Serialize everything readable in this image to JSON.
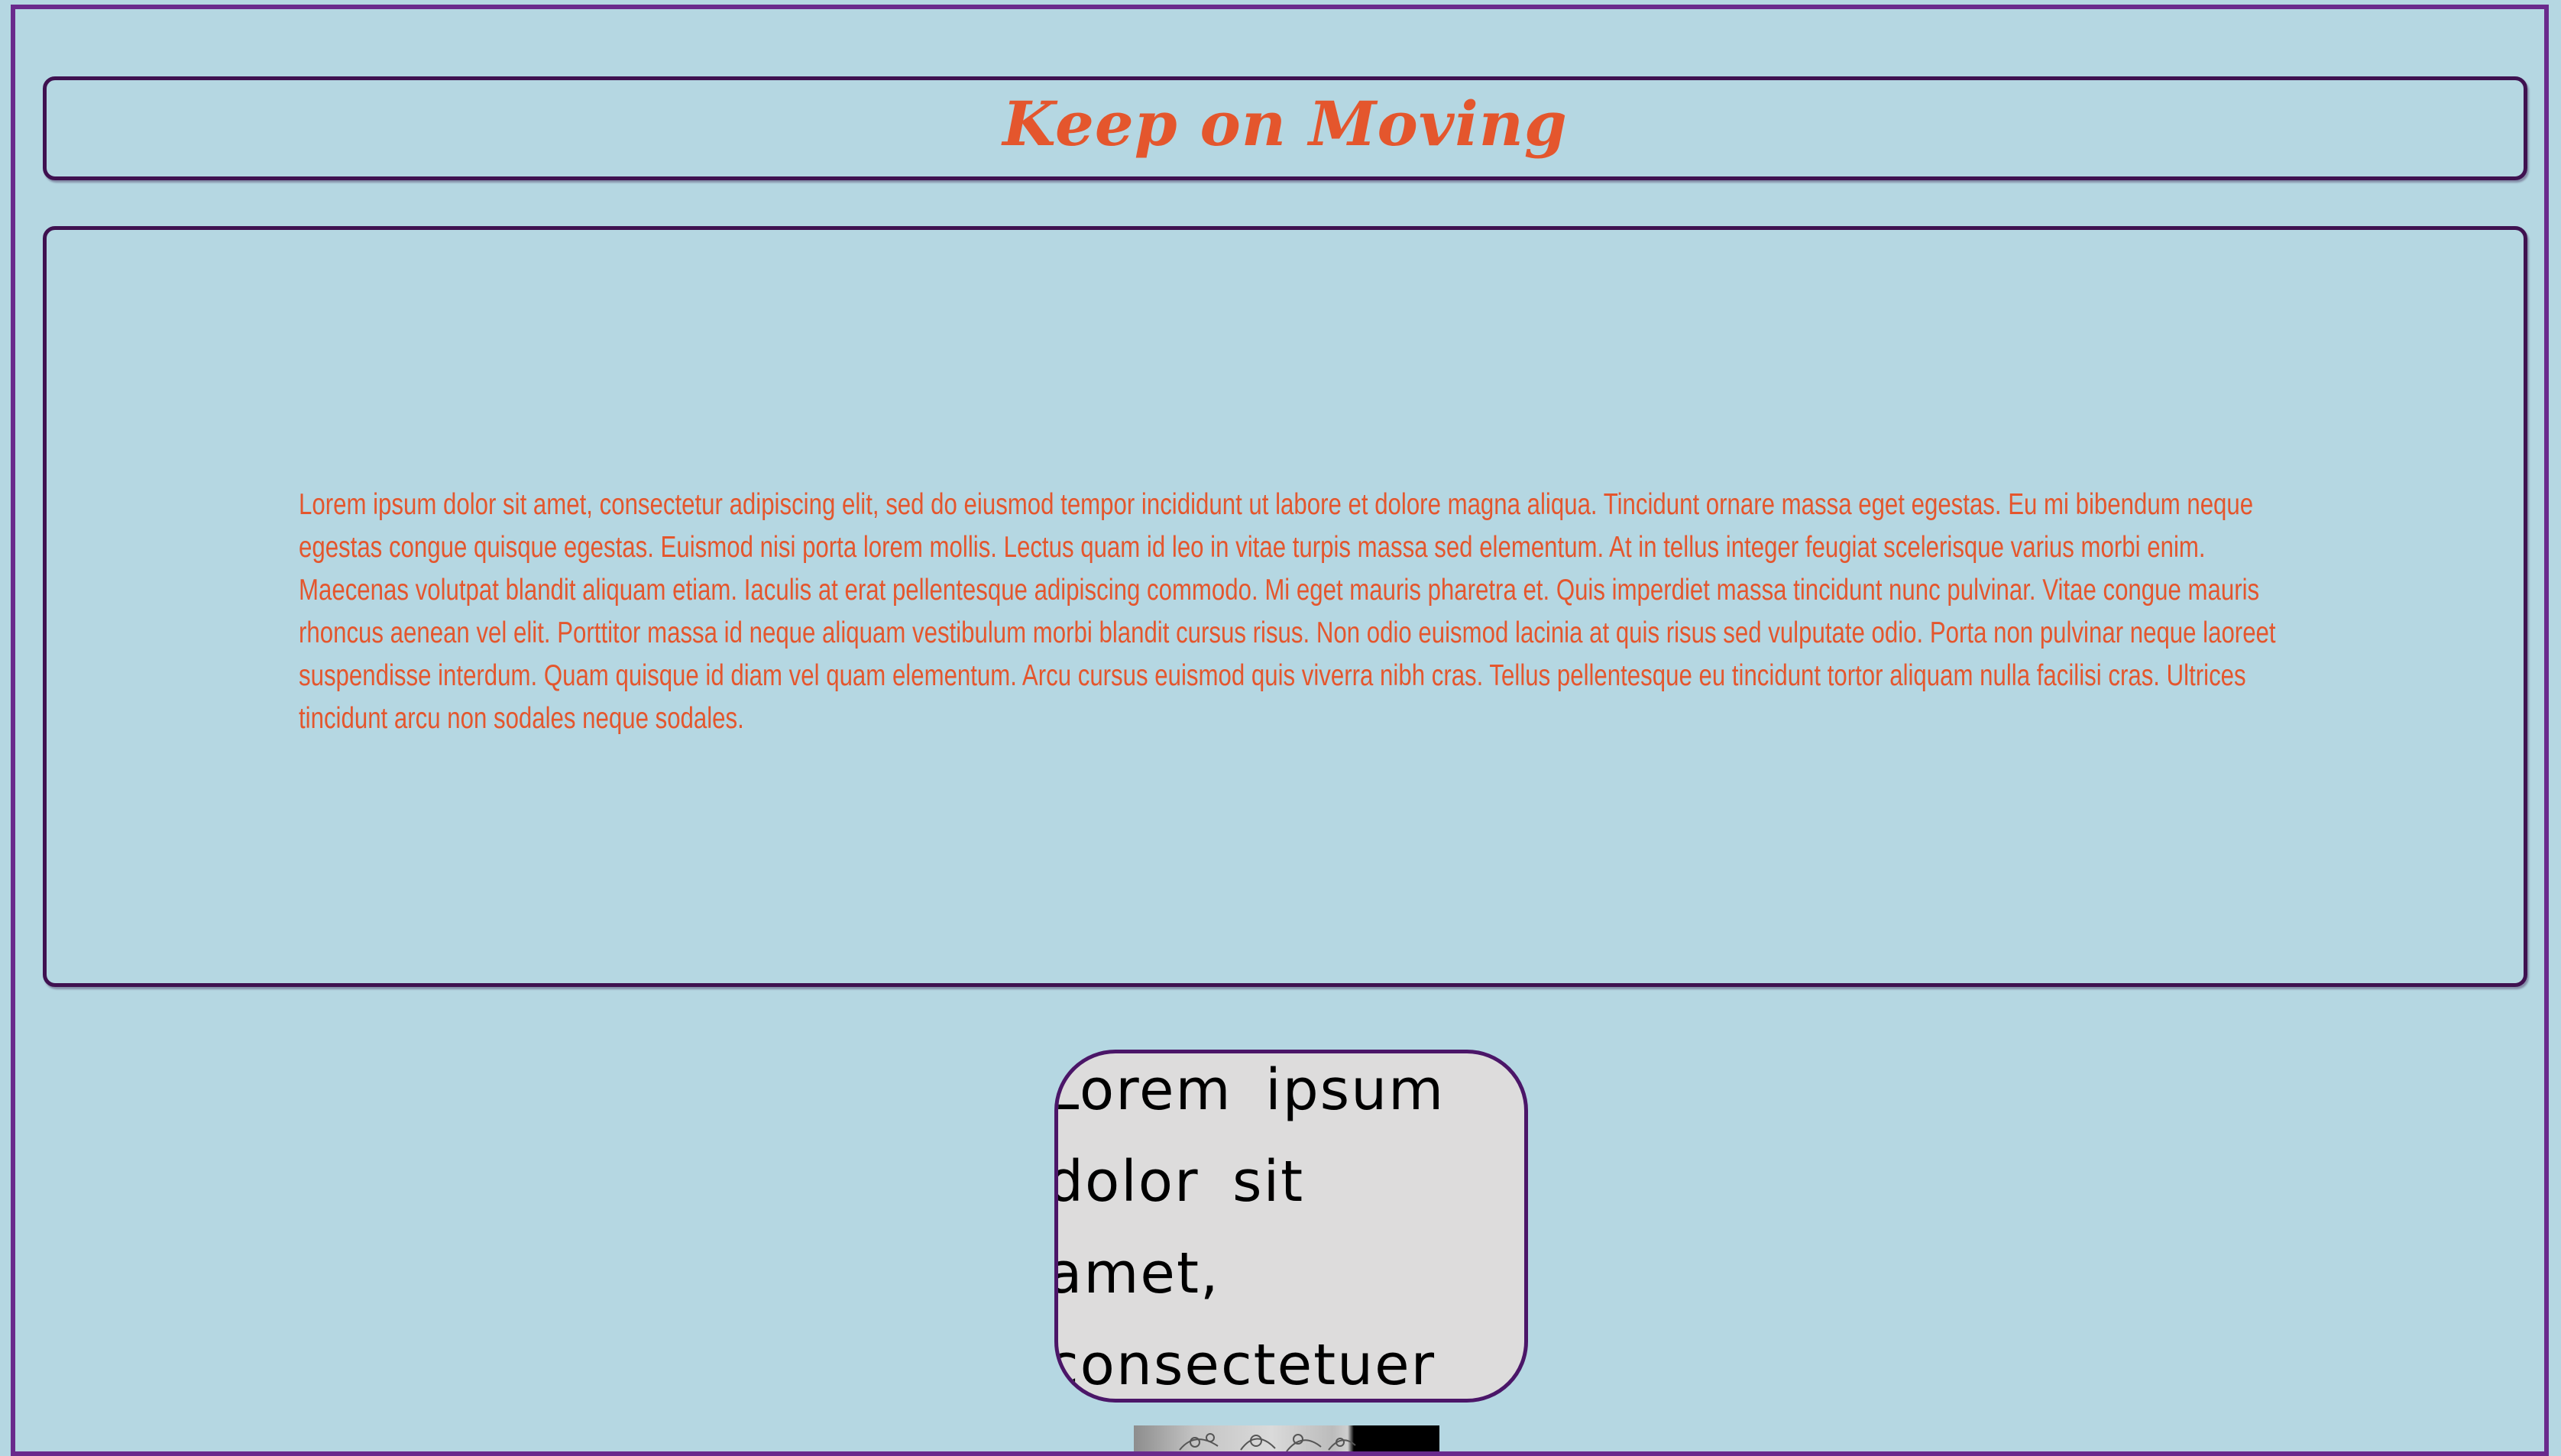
{
  "header": {
    "title": "Keep on Moving"
  },
  "main": {
    "paragraph": "Lorem ipsum dolor sit amet, consectetur adipiscing elit, sed do eiusmod tempor incididunt ut labore et dolore magna aliqua. Tincidunt ornare massa eget egestas. Eu mi bibendum neque egestas congue quisque egestas. Euismod nisi porta lorem mollis. Lectus quam id leo in vitae turpis massa sed elementum. At in tellus integer feugiat scelerisque varius morbi enim. Maecenas volutpat blandit aliquam etiam. Iaculis at erat pellentesque adipiscing commodo. Mi eget mauris pharetra et. Quis imperdiet massa tincidunt nunc pulvinar. Vitae congue mauris rhoncus aenean vel elit. Porttitor massa id neque aliquam vestibulum morbi blandit cursus risus. Non odio euismod lacinia at quis risus sed vulputate odio. Porta non pulvinar neque laoreet suspendisse interdum. Quam quisque id diam vel quam elementum. Arcu cursus euismod quis viverra nibh cras. Tellus pellentesque eu tincidunt tortor aliquam nulla facilisi cras. Ultrices tincidunt arcu non sodales neque sodales."
  },
  "card": {
    "text": "Lorem ipsum dolor sit amet, consectetuer adipiscing elit."
  },
  "colors": {
    "background": "#b5d7e2",
    "accent": "#e4562d",
    "border": "#3f1150",
    "card_background": "#dddcdc"
  },
  "image": {
    "icon": "floral-pattern-image"
  }
}
